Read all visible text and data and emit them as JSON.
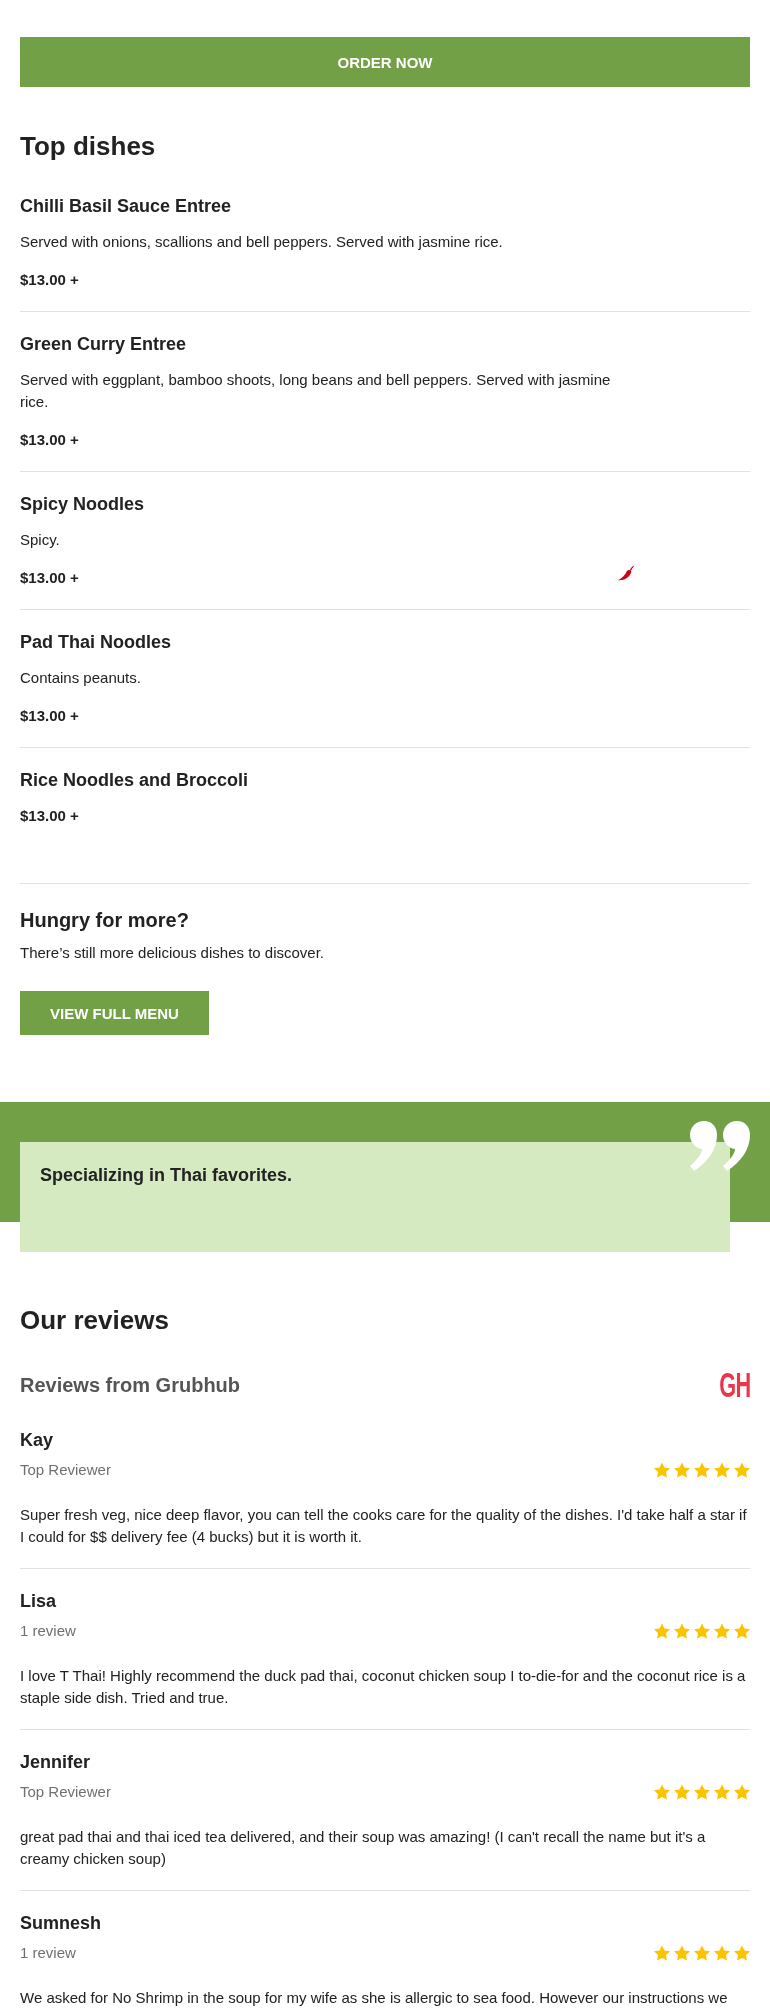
{
  "order_button": "ORDER NOW",
  "top_dishes": {
    "title": "Top dishes",
    "dishes": [
      {
        "name": "Chilli Basil Sauce Entree",
        "description": "Served with onions, scallions and bell peppers. Served with jasmine rice.",
        "price": "$13.00 +",
        "spicy": false
      },
      {
        "name": "Green Curry Entree",
        "description": "Served with eggplant, bamboo shoots, long beans and bell peppers. Served with jasmine rice.",
        "price": "$13.00 +",
        "spicy": false
      },
      {
        "name": "Spicy Noodles",
        "description": "Spicy.",
        "price": "$13.00 +",
        "spicy": true
      },
      {
        "name": "Pad Thai Noodles",
        "description": "Contains peanuts.",
        "price": "$13.00 +",
        "spicy": false
      },
      {
        "name": "Rice Noodles and Broccoli",
        "price": "$13.00 +",
        "spicy": false
      }
    ]
  },
  "more": {
    "title": "Hungry for more?",
    "text": "There’s still more delicious dishes to discover.",
    "button": "VIEW FULL MENU"
  },
  "quote": {
    "text": "Specializing in Thai favorites."
  },
  "reviews": {
    "title": "Our reviews",
    "source": "Reviews from Grubhub",
    "logo": "GH",
    "items": [
      {
        "name": "Kay",
        "label": "Top Reviewer",
        "stars": 5,
        "text": "Super fresh veg, nice deep flavor, you can tell the cooks care for the quality of the dishes. I'd take half a star if I could for $$ delivery fee (4 bucks) but it is worth it."
      },
      {
        "name": "Lisa",
        "label": "1 review",
        "stars": 5,
        "text": "I love T Thai! Highly recommend the duck pad thai, coconut chicken soup I to-die-for and the coconut rice is a staple side dish. Tried and true."
      },
      {
        "name": "Jennifer",
        "label": "Top Reviewer",
        "stars": 5,
        "text": "great pad thai and thai iced tea delivered, and their soup was amazing! (I can't recall the name but it's a creamy chicken soup)"
      },
      {
        "name": "Sumnesh",
        "label": "1 review",
        "stars": 5,
        "text": "We asked for No Shrimp in the soup for my wife as she is allergic to sea food. However our instructions we"
      }
    ]
  }
}
